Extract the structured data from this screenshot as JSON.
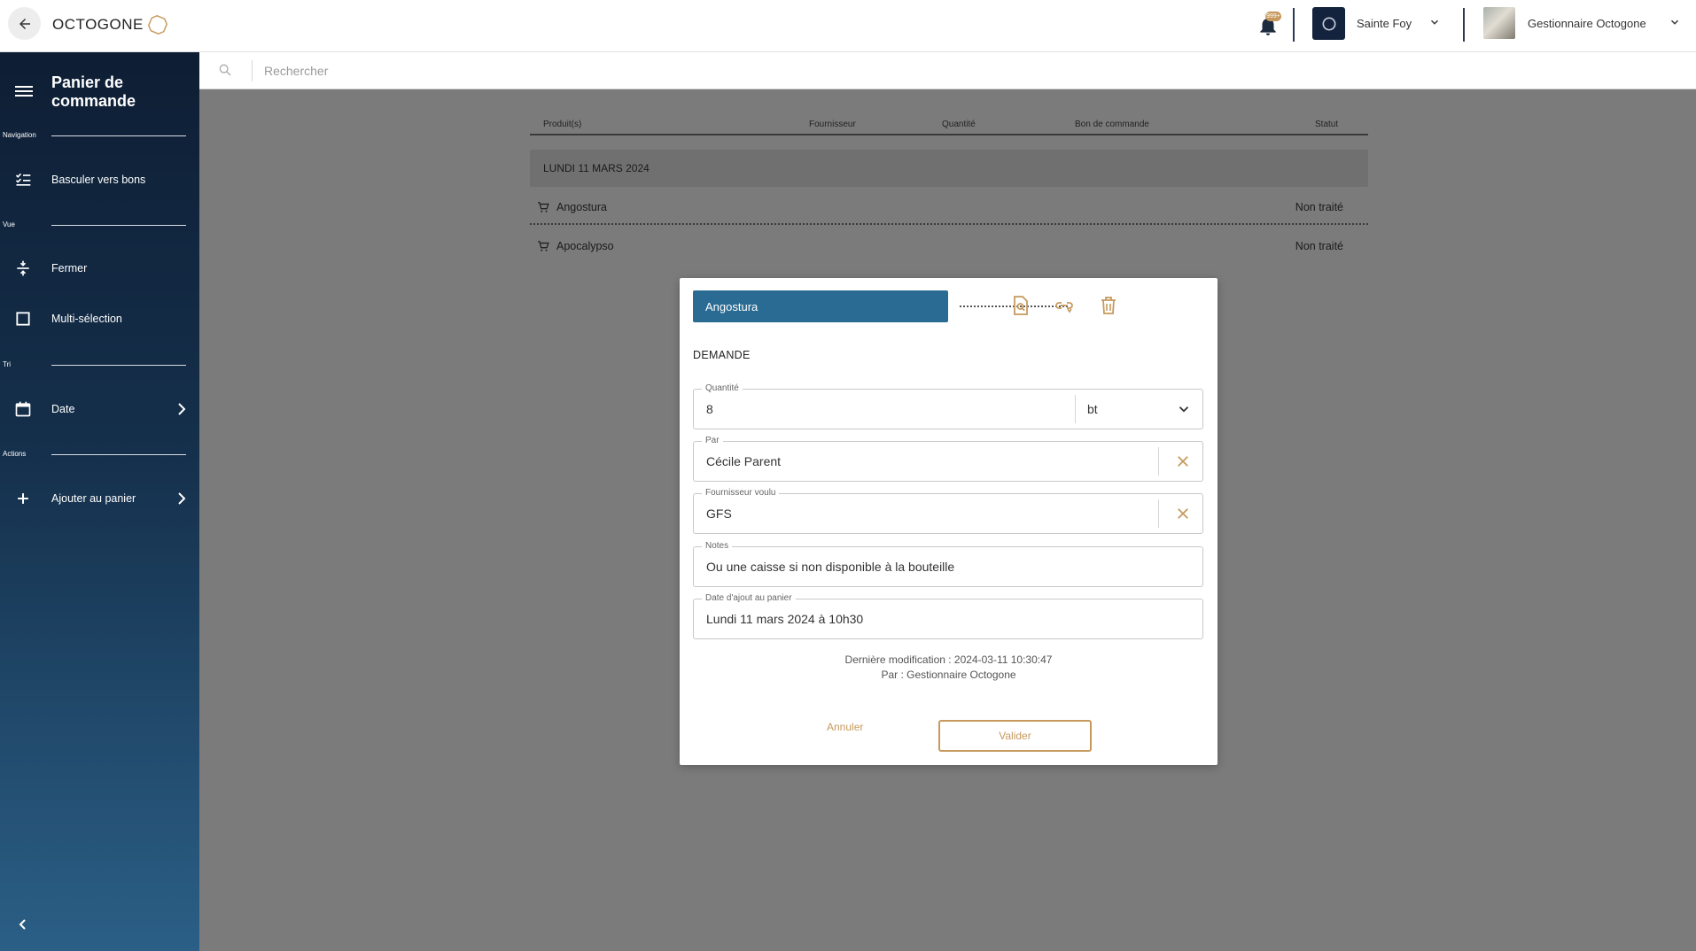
{
  "colors": {
    "accent": "#c69a5e",
    "primary": "#2a6b93",
    "sidebar_top": "#0e1e34",
    "sidebar_bottom": "#2b5f86",
    "overlay": "#7b7b7b"
  },
  "header": {
    "logo_text": "OCTOGONE",
    "notification_count": "999+",
    "site_name": "Sainte Foy",
    "user_name": "Gestionnaire Octogone"
  },
  "sidebar": {
    "title": "Panier de commande",
    "sections": {
      "navigation": "Navigation",
      "vue": "Vue",
      "tri": "Tri",
      "actions": "Actions"
    },
    "items": [
      {
        "label": "Basculer vers bons",
        "icon": "checklist-icon"
      },
      {
        "label": "Fermer",
        "icon": "collapse-vertical-icon"
      },
      {
        "label": "Multi-sélection",
        "icon": "checkbox-icon"
      },
      {
        "label": "Date",
        "icon": "calendar-icon"
      },
      {
        "label": "Ajouter au panier",
        "icon": "plus-icon"
      }
    ]
  },
  "search": {
    "placeholder": "Rechercher"
  },
  "table": {
    "headers": [
      "Produit(s)",
      "Fournisseur",
      "Quantité",
      "Bon de commande",
      "Statut"
    ],
    "group_label": "LUNDI 11 MARS 2024",
    "rows": [
      {
        "name": "Angostura",
        "status": "Non traité"
      },
      {
        "name": "Apocalypso",
        "status": "Non traité"
      }
    ]
  },
  "modal": {
    "product_name": "Angostura",
    "section_title": "DEMANDE",
    "fields": {
      "quantity": {
        "label": "Quantité",
        "value": "8",
        "unit": "bt"
      },
      "par": {
        "label": "Par",
        "value": "Cécile Parent"
      },
      "supplier": {
        "label": "Fournisseur voulu",
        "value": "GFS"
      },
      "notes": {
        "label": "Notes",
        "value": "Ou une caisse si non disponible à la bouteille"
      },
      "date_added": {
        "label": "Date d'ajout au panier",
        "value": "Lundi 11 mars 2024 à 10h30"
      }
    },
    "last_modified": "Dernière modification : 2024-03-11 10:30:47",
    "modified_by": "Par : Gestionnaire Octogone",
    "cancel_label": "Annuler",
    "validate_label": "Valider"
  }
}
